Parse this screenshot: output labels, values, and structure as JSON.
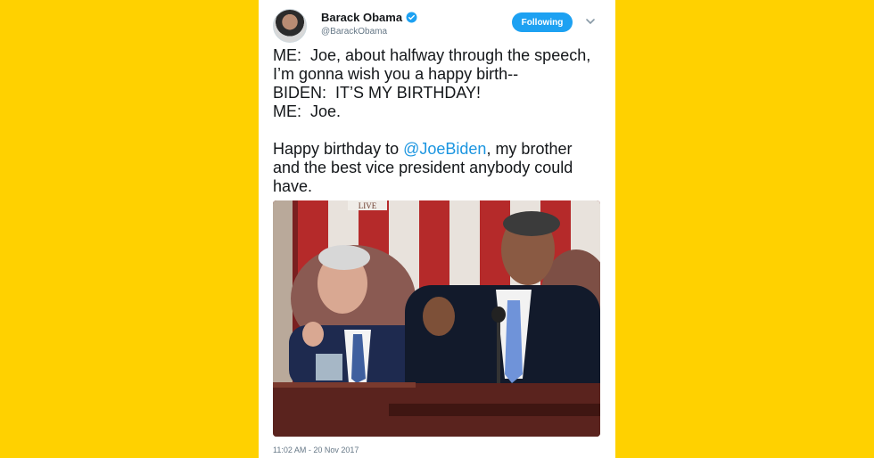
{
  "tweet": {
    "author_name": "Barack Obama",
    "handle": "@BarackObama",
    "follow_label": "Following",
    "text_lines": [
      "ME:  Joe, about halfway through the speech,",
      "I’m gonna wish you a happy birth--",
      "BIDEN:  IT’S MY BIRTHDAY!",
      "ME:  Joe."
    ],
    "text_pre_mention": "Happy birthday to ",
    "mention": "@JoeBiden",
    "text_post_mention": ", my brother\nand the best vice president anybody could\nhave.",
    "media_badge": "LIVE",
    "timestamp": "11:02 AM - 20 Nov 2017"
  },
  "colors": {
    "background": "#FFD100",
    "accent": "#1da1f2",
    "mention": "#1b95e0"
  },
  "icons": {
    "verified": "verified-badge-icon",
    "chevron": "chevron-down-icon"
  }
}
